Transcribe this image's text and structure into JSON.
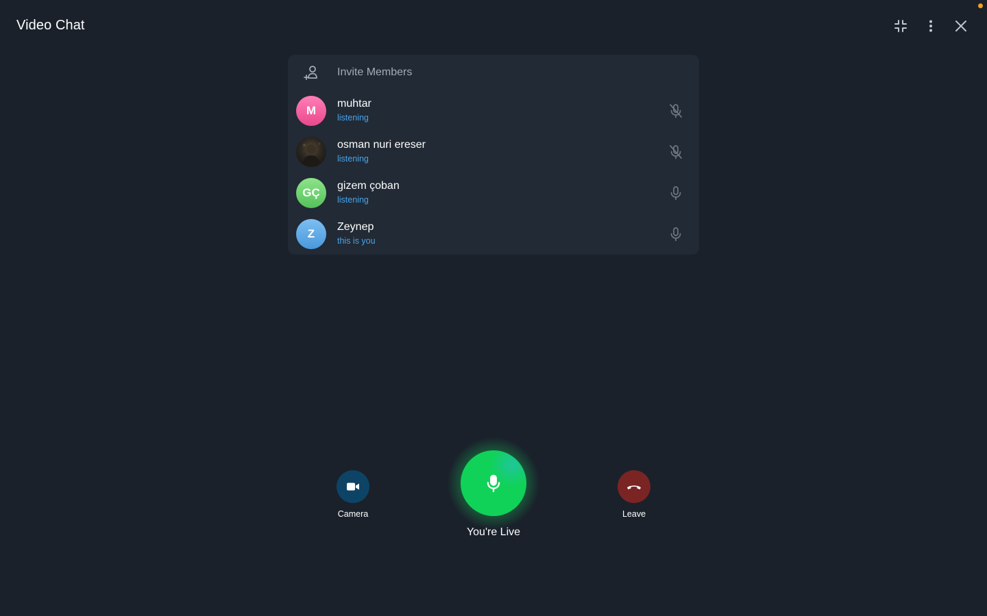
{
  "window": {
    "title": "Video Chat"
  },
  "top_actions": {
    "minimize_icon": "shrink-arrows-icon",
    "more_icon": "vertical-dots-icon",
    "close_icon": "close-icon"
  },
  "invite": {
    "label": "Invite Members",
    "icon": "add-user-icon"
  },
  "members": [
    {
      "name": "muhtar",
      "status": "listening",
      "initials": "M",
      "avatar_color": "#f25a9c",
      "mic": "mic-muted-icon"
    },
    {
      "name": "osman nuri ereser",
      "status": "listening",
      "initials": "",
      "avatar_color": "#2a2620",
      "mic": "mic-muted-icon"
    },
    {
      "name": "gizem çoban",
      "status": "listening",
      "initials": "GÇ",
      "avatar_color": "#6cce6e",
      "mic": "mic-icon"
    },
    {
      "name": "Zeynep",
      "status": "this is you",
      "initials": "Z",
      "avatar_color": "#5aa8e6",
      "mic": "mic-icon"
    }
  ],
  "controls": {
    "camera_label": "Camera",
    "live_label": "You're Live",
    "leave_label": "Leave"
  },
  "colors": {
    "background": "#1a212b",
    "panel": "#212a35",
    "accent_blue": "#4aa3e8",
    "live_green": "#16d25a",
    "leave_red": "#7a2424",
    "camera_blue": "#0d4466",
    "notification": "#f0a020"
  }
}
